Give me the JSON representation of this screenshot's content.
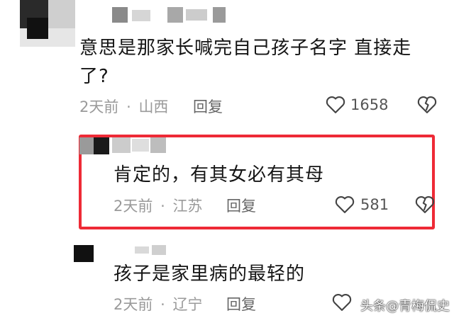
{
  "comments": [
    {
      "text_line1": "意思是那家长喊完自己孩子名字 直接走",
      "text_line2": "了?",
      "time": "2天前",
      "region": "山西",
      "reply_label": "回复",
      "like_count": "1658"
    },
    {
      "text": "肯定的，有其女必有其母",
      "time": "2天前",
      "region": "江苏",
      "reply_label": "回复",
      "like_count": "581"
    },
    {
      "text": "孩子是家里病的最轻的",
      "time": "2天前",
      "region": "辽宁",
      "reply_label": "回复"
    }
  ],
  "separator": "·",
  "watermark": "头条@青梅侃史",
  "icons": {
    "like": "heart-outline-icon",
    "dislike": "broken-heart-icon"
  },
  "colors": {
    "highlight_border": "#ee2a36",
    "meta_text": "#9a9a9a"
  }
}
